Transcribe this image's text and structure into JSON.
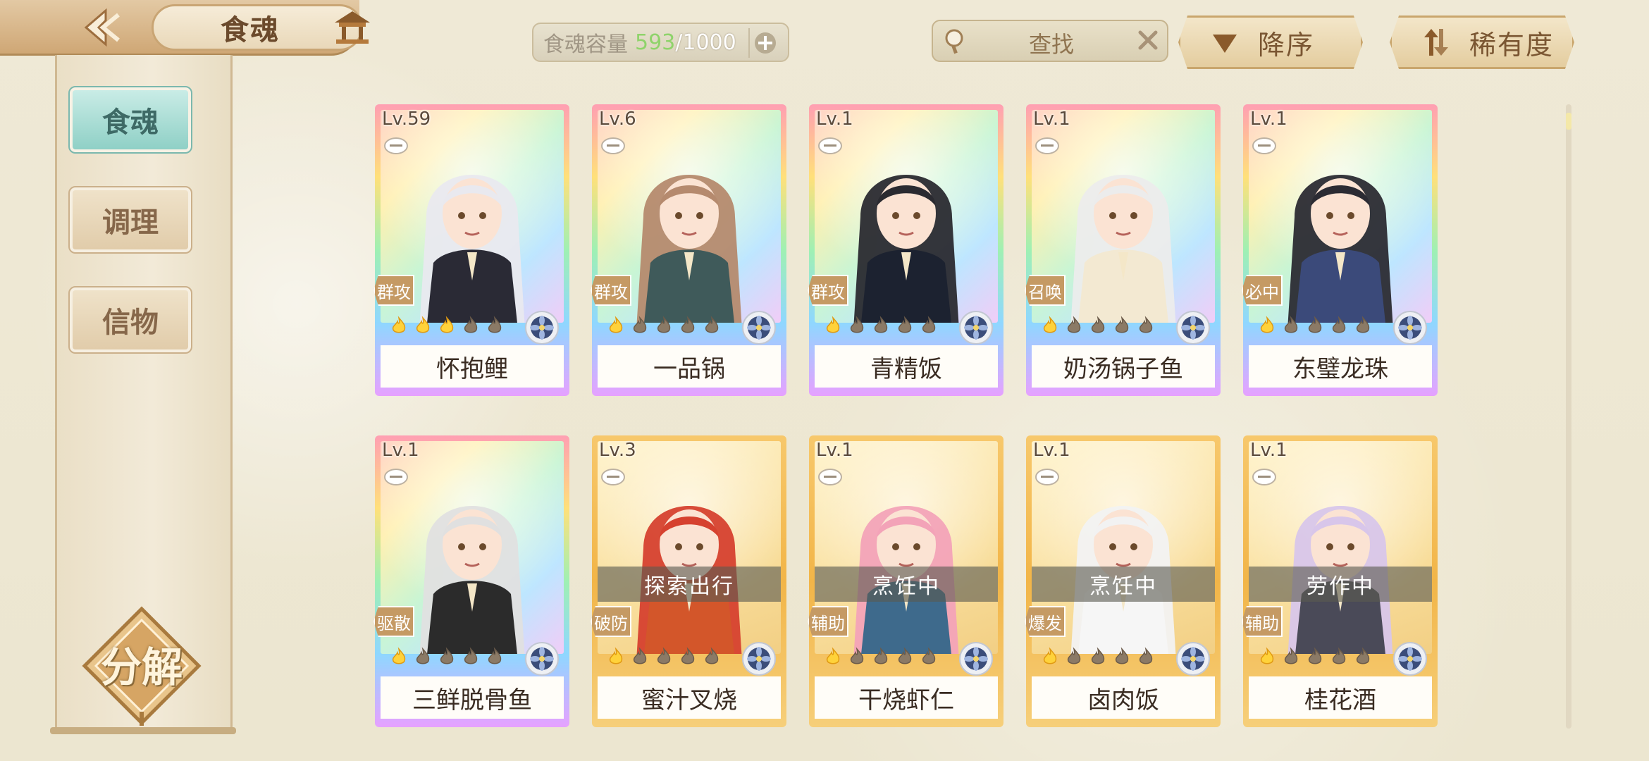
{
  "header": {
    "title": "食魂",
    "capacity": {
      "label": "食魂容量",
      "current": "593",
      "max": "/1000"
    },
    "search": {
      "label": "查找"
    },
    "sort_order": {
      "label": "降序"
    },
    "sort_key": {
      "label": "稀有度"
    }
  },
  "sidebar": {
    "tabs": [
      {
        "label": "食魂",
        "active": true
      },
      {
        "label": "调理",
        "active": false
      },
      {
        "label": "信物",
        "active": false
      }
    ],
    "decompose_label": "分解"
  },
  "cards": [
    {
      "level": "Lv.59",
      "role": "群攻",
      "name": "怀抱鲤",
      "frame": "rainbow",
      "stars_lit": 3,
      "status": ""
    },
    {
      "level": "Lv.6",
      "role": "群攻",
      "name": "一品锅",
      "frame": "rainbow",
      "stars_lit": 1,
      "status": ""
    },
    {
      "level": "Lv.1",
      "role": "群攻",
      "name": "青精饭",
      "frame": "rainbow",
      "stars_lit": 1,
      "status": ""
    },
    {
      "level": "Lv.1",
      "role": "召唤",
      "name": "奶汤锅子鱼",
      "frame": "rainbow",
      "stars_lit": 1,
      "status": ""
    },
    {
      "level": "Lv.1",
      "role": "必中",
      "name": "东璧龙珠",
      "frame": "rainbow",
      "stars_lit": 1,
      "status": ""
    },
    {
      "level": "Lv.1",
      "role": "驱散",
      "name": "三鲜脱骨鱼",
      "frame": "rainbow",
      "stars_lit": 1,
      "status": ""
    },
    {
      "level": "Lv.3",
      "role": "破防",
      "name": "蜜汁叉烧",
      "frame": "gold",
      "stars_lit": 1,
      "status": "探索出行"
    },
    {
      "level": "Lv.1",
      "role": "辅助",
      "name": "干烧虾仁",
      "frame": "gold",
      "stars_lit": 1,
      "status": "烹饪中"
    },
    {
      "level": "Lv.1",
      "role": "爆发",
      "name": "卤肉饭",
      "frame": "gold",
      "stars_lit": 1,
      "status": "烹饪中"
    },
    {
      "level": "Lv.1",
      "role": "辅助",
      "name": "桂花酒",
      "frame": "gold",
      "stars_lit": 1,
      "status": "劳作中"
    }
  ],
  "colors": {
    "accent_teal": "#8fd0c6",
    "capacity_current": "#8fd36b",
    "gold_frame": "#f2b548"
  },
  "icons": [
    "back-arrow-icon",
    "pavilion-icon",
    "plus-icon",
    "search-icon",
    "clear-icon",
    "sort-down-icon",
    "sort-swap-icon",
    "bowl-icon",
    "flame-icon",
    "element-flower-icon"
  ]
}
